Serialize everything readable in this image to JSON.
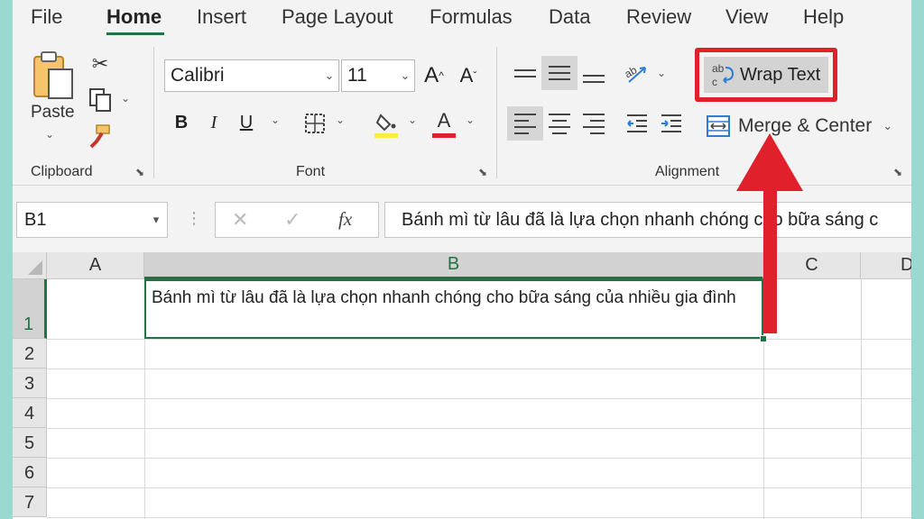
{
  "ribbon_tabs": [
    {
      "label": "File"
    },
    {
      "label": "Home",
      "active": true
    },
    {
      "label": "Insert"
    },
    {
      "label": "Page Layout"
    },
    {
      "label": "Formulas"
    },
    {
      "label": "Data"
    },
    {
      "label": "Review"
    },
    {
      "label": "View"
    },
    {
      "label": "Help"
    }
  ],
  "clipboard": {
    "paste_label": "Paste",
    "group_label": "Clipboard"
  },
  "font": {
    "name": "Calibri",
    "size": "11",
    "group_label": "Font",
    "highlight_color": "#ffeb3b",
    "font_color": "#e0202a"
  },
  "alignment": {
    "wrap_text_label": "Wrap Text",
    "merge_center_label": "Merge & Center",
    "group_label": "Alignment"
  },
  "formula_bar": {
    "name_box": "B1",
    "formula": "Bánh mì từ lâu đã là lựa chọn nhanh chóng cho bữa sáng c"
  },
  "grid": {
    "columns": [
      "A",
      "B",
      "C",
      "D"
    ],
    "rows": [
      "1",
      "2",
      "3",
      "4",
      "5",
      "6",
      "7"
    ],
    "selected_cell": "B1",
    "b1_value": "Bánh mì từ lâu đã là lựa chọn nhanh chóng cho bữa sáng của nhiều gia đình"
  },
  "colors": {
    "accent": "#217346",
    "highlight_box": "#e0202a",
    "background": "#99d9cf"
  }
}
